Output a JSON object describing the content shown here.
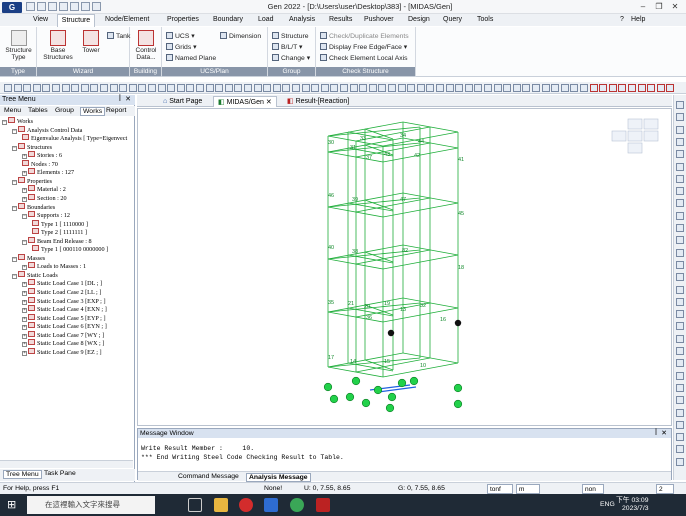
{
  "window": {
    "title": "Gen 2022 - [D:\\Users\\user\\Desktop\\383] - [MIDAS/Gen]",
    "logo": "G",
    "minimize": "–",
    "restore": "❐",
    "close": "✕"
  },
  "menu_tabs": [
    "View",
    "Structure",
    "Node/Element",
    "Properties",
    "Boundary",
    "Load",
    "Analysis",
    "Results",
    "Pushover",
    "Design",
    "Query",
    "Tools"
  ],
  "help_label": "Help",
  "ribbon": {
    "type_group": {
      "label": "Type",
      "structure_type": "Structure Type"
    },
    "wizard_group": {
      "label": "Wizard",
      "base_structures": "Base Structures",
      "tower": "Tower",
      "tank": "Tank"
    },
    "building_group": {
      "label": "Building",
      "control_data": "Control Data..."
    },
    "ucs_group": {
      "label": "UCS/Plan",
      "ucs": "UCS",
      "grids": "Grids",
      "named_plane": "Named Plane",
      "dimension": "Dimension"
    },
    "group_group": {
      "label": "Group",
      "structure": "Structure",
      "blt": "B/L/T",
      "change": "Change"
    },
    "check_group": {
      "label": "Check Structure",
      "check_duplicate": "Check/Duplicate Elements",
      "display_free_edge": "Display Free Edge/Face",
      "check_element_local_axis": "Check Element Local Axis"
    }
  },
  "tree": {
    "title": "Tree Menu",
    "tabs": [
      "Menu",
      "Tables",
      "Group",
      "Works",
      "Report"
    ],
    "nodes": [
      {
        "text": "Works",
        "indent": 0,
        "exp": "-"
      },
      {
        "text": "Analysis Control Data",
        "indent": 1,
        "exp": "-"
      },
      {
        "text": "Eigenvalue Analysis [ Type=Eigenvect",
        "indent": 2,
        "exp": ""
      },
      {
        "text": "Structures",
        "indent": 1,
        "exp": "-"
      },
      {
        "text": "Stories : 6",
        "indent": 2,
        "exp": "+"
      },
      {
        "text": "Nodes : 70",
        "indent": 2,
        "exp": ""
      },
      {
        "text": "Elements : 127",
        "indent": 2,
        "exp": "+"
      },
      {
        "text": "Properties",
        "indent": 1,
        "exp": "-"
      },
      {
        "text": "Material : 2",
        "indent": 2,
        "exp": "+"
      },
      {
        "text": "Section : 20",
        "indent": 2,
        "exp": "+"
      },
      {
        "text": "Boundaries",
        "indent": 1,
        "exp": "-"
      },
      {
        "text": "Supports : 12",
        "indent": 2,
        "exp": "-"
      },
      {
        "text": "Type 1 [ 1110000 ]",
        "indent": 3,
        "exp": ""
      },
      {
        "text": "Type 2 [ 1111111 ]",
        "indent": 3,
        "exp": ""
      },
      {
        "text": "Beam End Release : 8",
        "indent": 2,
        "exp": "-"
      },
      {
        "text": "Type 1 [ 000110 0000000 ]",
        "indent": 3,
        "exp": ""
      },
      {
        "text": "Masses",
        "indent": 1,
        "exp": "-"
      },
      {
        "text": "Loads to Masses : 1",
        "indent": 2,
        "exp": "+"
      },
      {
        "text": "Static Loads",
        "indent": 1,
        "exp": "-"
      },
      {
        "text": "Static Load Case 1 [DL ; ]",
        "indent": 2,
        "exp": "+"
      },
      {
        "text": "Static Load Case 2 [LL ; ]",
        "indent": 2,
        "exp": "+"
      },
      {
        "text": "Static Load Case 3 [EXP ; ]",
        "indent": 2,
        "exp": "+"
      },
      {
        "text": "Static Load Case 4 [EXN ; ]",
        "indent": 2,
        "exp": "+"
      },
      {
        "text": "Static Load Case 5 [EYP ; ]",
        "indent": 2,
        "exp": "+"
      },
      {
        "text": "Static Load Case 6 [EYN ; ]",
        "indent": 2,
        "exp": "+"
      },
      {
        "text": "Static Load Case 7 [WY ; ]",
        "indent": 2,
        "exp": "+"
      },
      {
        "text": "Static Load Case 8 [WX ; ]",
        "indent": 2,
        "exp": "+"
      },
      {
        "text": "Static Load Case 9 [EZ ; ]",
        "indent": 2,
        "exp": "+"
      }
    ],
    "bottom_tabs": [
      "Tree Menu",
      "Task Pane"
    ]
  },
  "doc_tabs": [
    "Start Page",
    "MIDAS/Gen",
    "Result-[Reaction]"
  ],
  "message_window": {
    "title": "Message Window",
    "lines": [
      "Write Result Member :     10.",
      "*** End Writing Steel Code Checking Result to Table."
    ],
    "tabs": [
      "Command Message",
      "Analysis Message"
    ]
  },
  "status": {
    "help": "For Help, press F1",
    "selection": "None!",
    "u_coord": "U: 0, 7.55, 8.65",
    "g_coord": "G: 0, 7.55, 8.65",
    "force_unit": "tonf",
    "length_unit": "m",
    "option": "non",
    "page": "2"
  },
  "taskbar": {
    "search_placeholder": "在這裡輸入文字來搜尋",
    "language": "ENG",
    "time": "下午 03:09",
    "date": "2023/7/3"
  },
  "colors": {
    "frame": "#1fae3a",
    "support": "#22d14a",
    "accent": "#2b5aa3"
  },
  "node_labels": [
    "30",
    "33",
    "31",
    "44",
    "34",
    "37",
    "43",
    "42",
    "41",
    "46",
    "39",
    "47",
    "45",
    "40",
    "38",
    "82",
    "18",
    "21",
    "19",
    "32",
    "35",
    "20",
    "13",
    "36",
    "16",
    "17",
    "14",
    "15",
    "10"
  ]
}
